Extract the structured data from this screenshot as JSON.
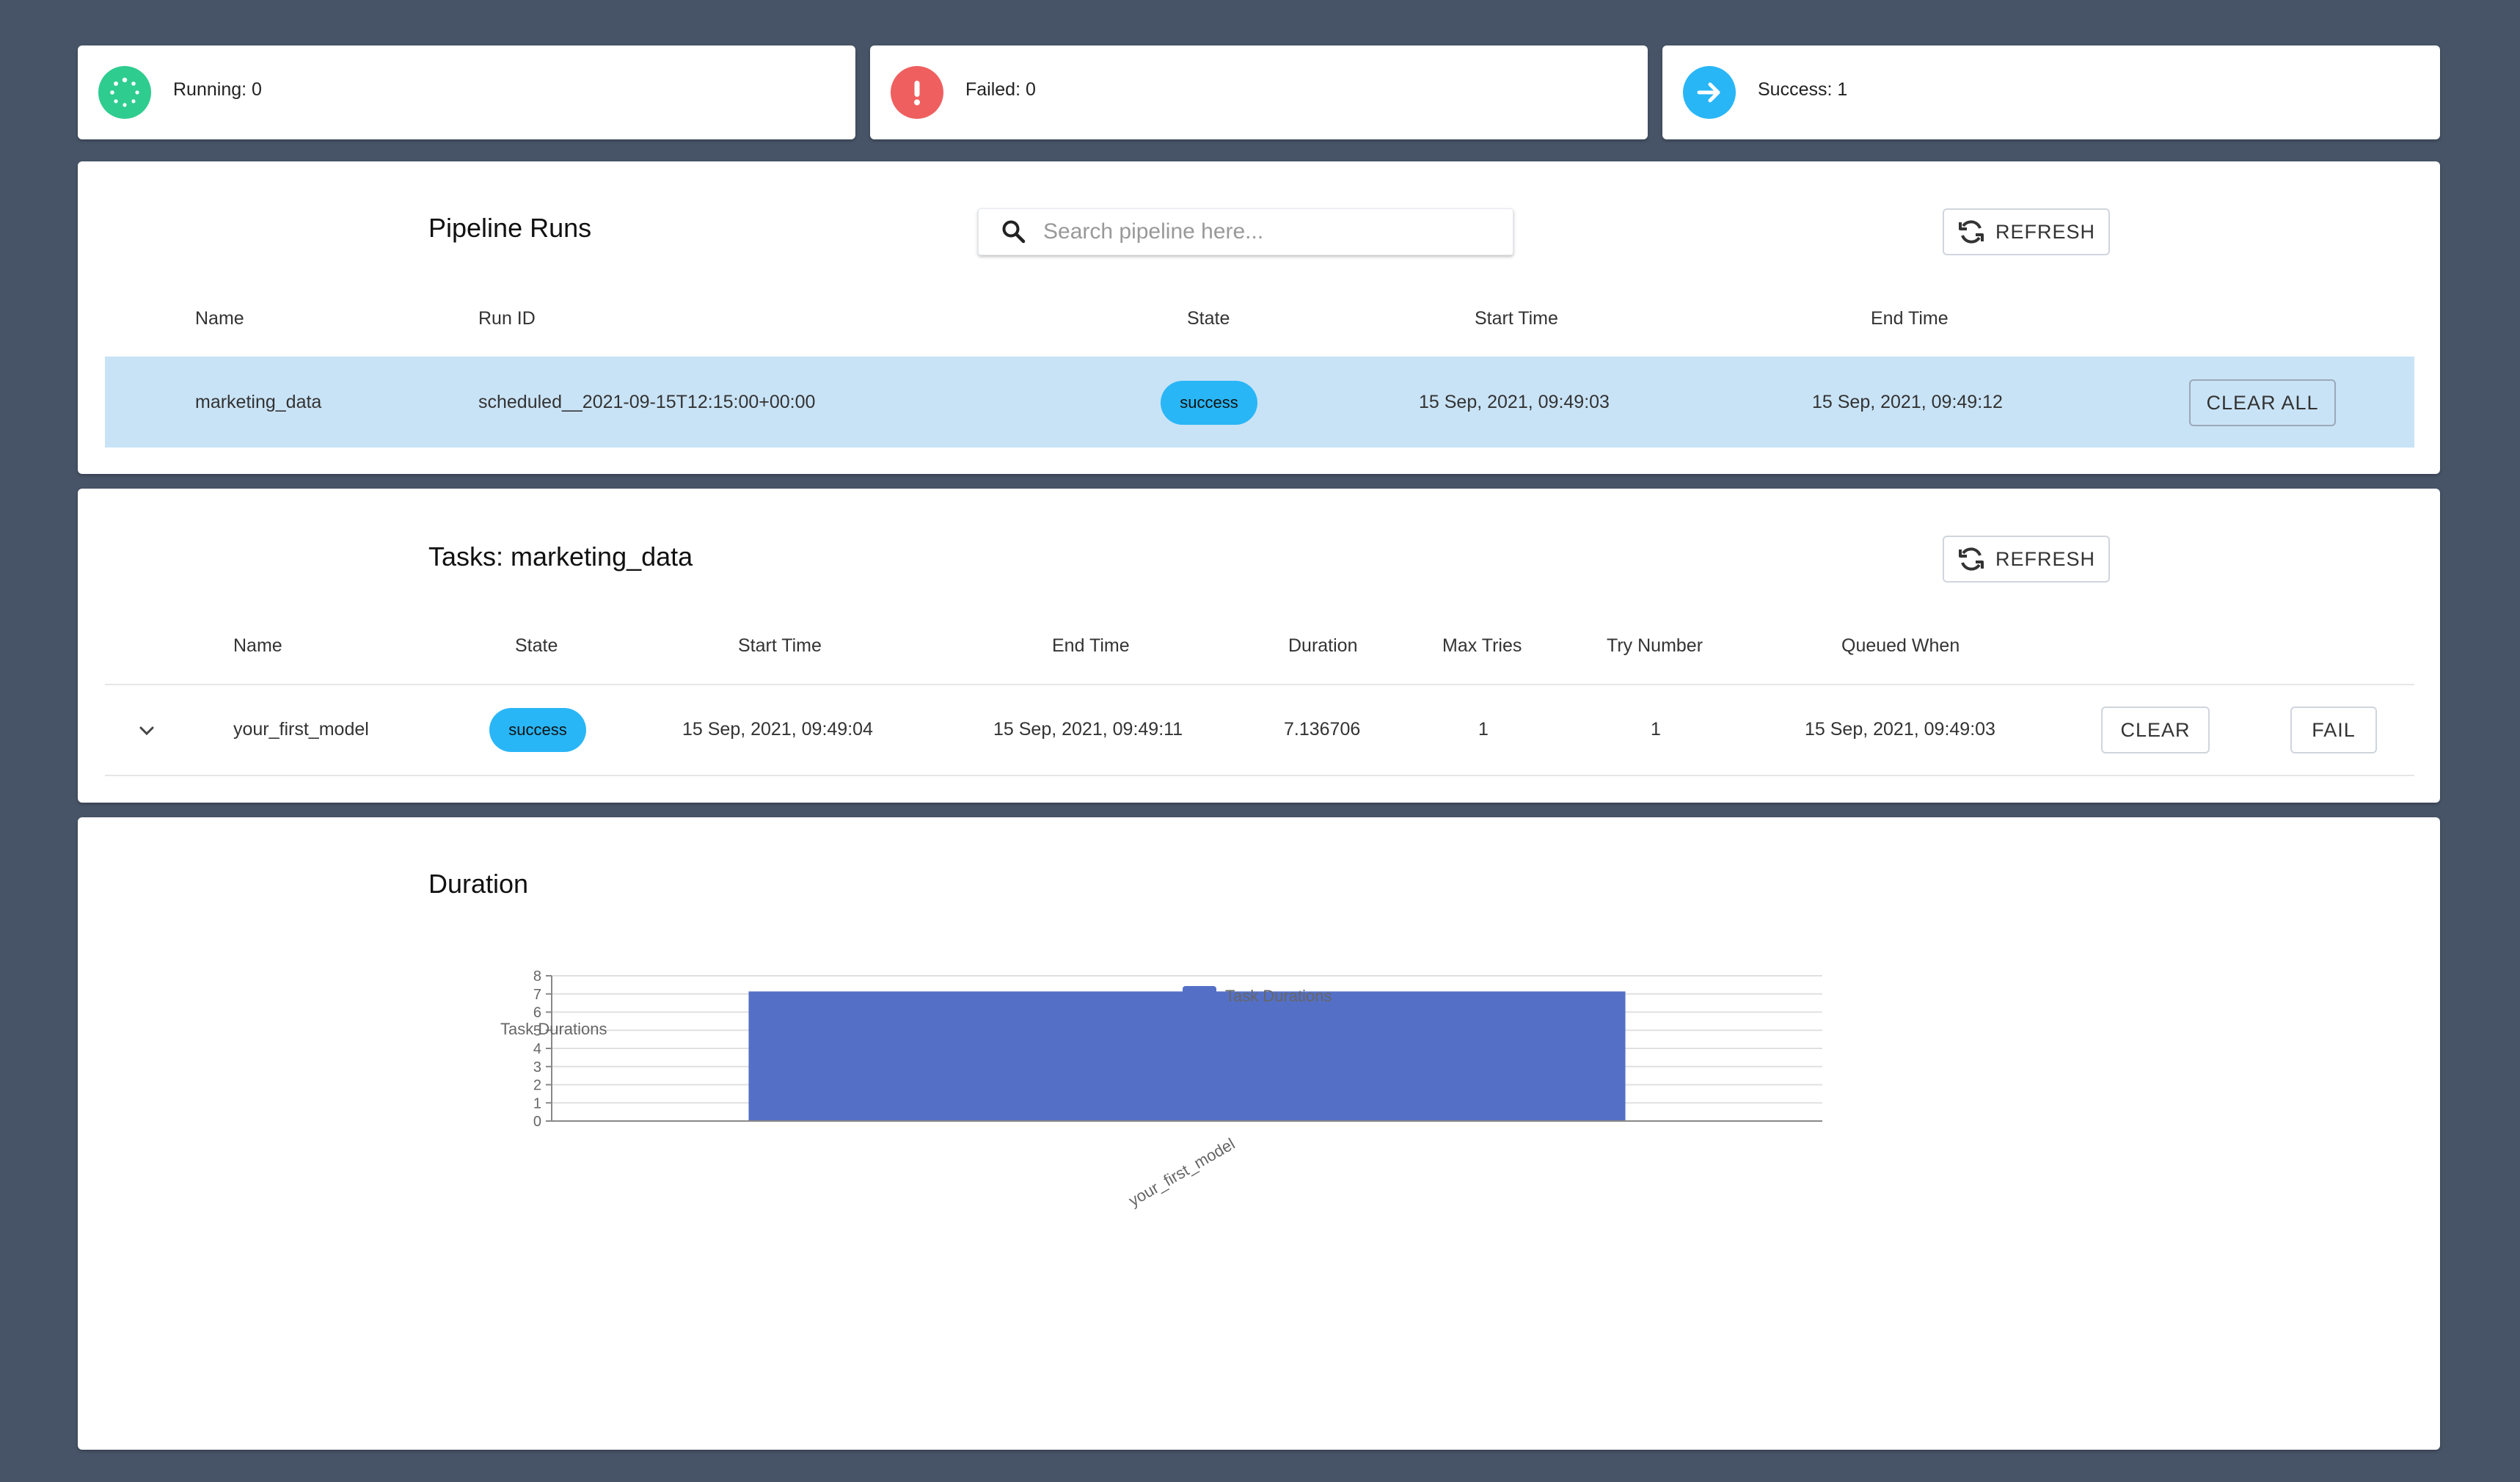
{
  "status_cards": {
    "running": "Running: 0",
    "failed": "Failed: 0",
    "success": "Success: 1",
    "colors": {
      "running": "#2ecc8f",
      "failed": "#ef5f5f",
      "success": "#29b6f6"
    }
  },
  "pipeline_runs": {
    "title": "Pipeline Runs",
    "search_placeholder": "Search pipeline here...",
    "refresh_label": "REFRESH",
    "headers": {
      "name": "Name",
      "run_id": "Run ID",
      "state": "State",
      "start_time": "Start Time",
      "end_time": "End Time"
    },
    "rows": [
      {
        "name": "marketing_data",
        "run_id": "scheduled__2021-09-15T12:15:00+00:00",
        "state": "success",
        "start_time": "15 Sep, 2021, 09:49:03",
        "end_time": "15 Sep, 2021, 09:49:12",
        "clear_all_label": "CLEAR ALL"
      }
    ],
    "selected_row_color": "#c9e3f6"
  },
  "tasks": {
    "title": "Tasks: marketing_data",
    "refresh_label": "REFRESH",
    "headers": {
      "name": "Name",
      "state": "State",
      "start_time": "Start Time",
      "end_time": "End Time",
      "duration": "Duration",
      "max_tries": "Max Tries",
      "try_number": "Try Number",
      "queued_when": "Queued When"
    },
    "rows": [
      {
        "name": "your_first_model",
        "state": "success",
        "start_time": "15 Sep, 2021, 09:49:04",
        "end_time": "15 Sep, 2021, 09:49:11",
        "duration": "7.136706",
        "max_tries": "1",
        "try_number": "1",
        "queued_when": "15 Sep, 2021, 09:49:03",
        "clear_label": "CLEAR",
        "fail_label": "FAIL"
      }
    ]
  },
  "duration_section": {
    "title": "Duration"
  },
  "chart_data": {
    "type": "bar",
    "categories": [
      "your_first_model"
    ],
    "series": [
      {
        "name": "Task Durations",
        "values": [
          7.136706
        ],
        "color": "#5470c6"
      }
    ],
    "ylabel": "Task Durations",
    "ylim": [
      0,
      8
    ],
    "yticks": [
      "0",
      "1",
      "2",
      "3",
      "4",
      "5",
      "6",
      "7",
      "8"
    ],
    "legend": "top-center",
    "grid": true
  }
}
